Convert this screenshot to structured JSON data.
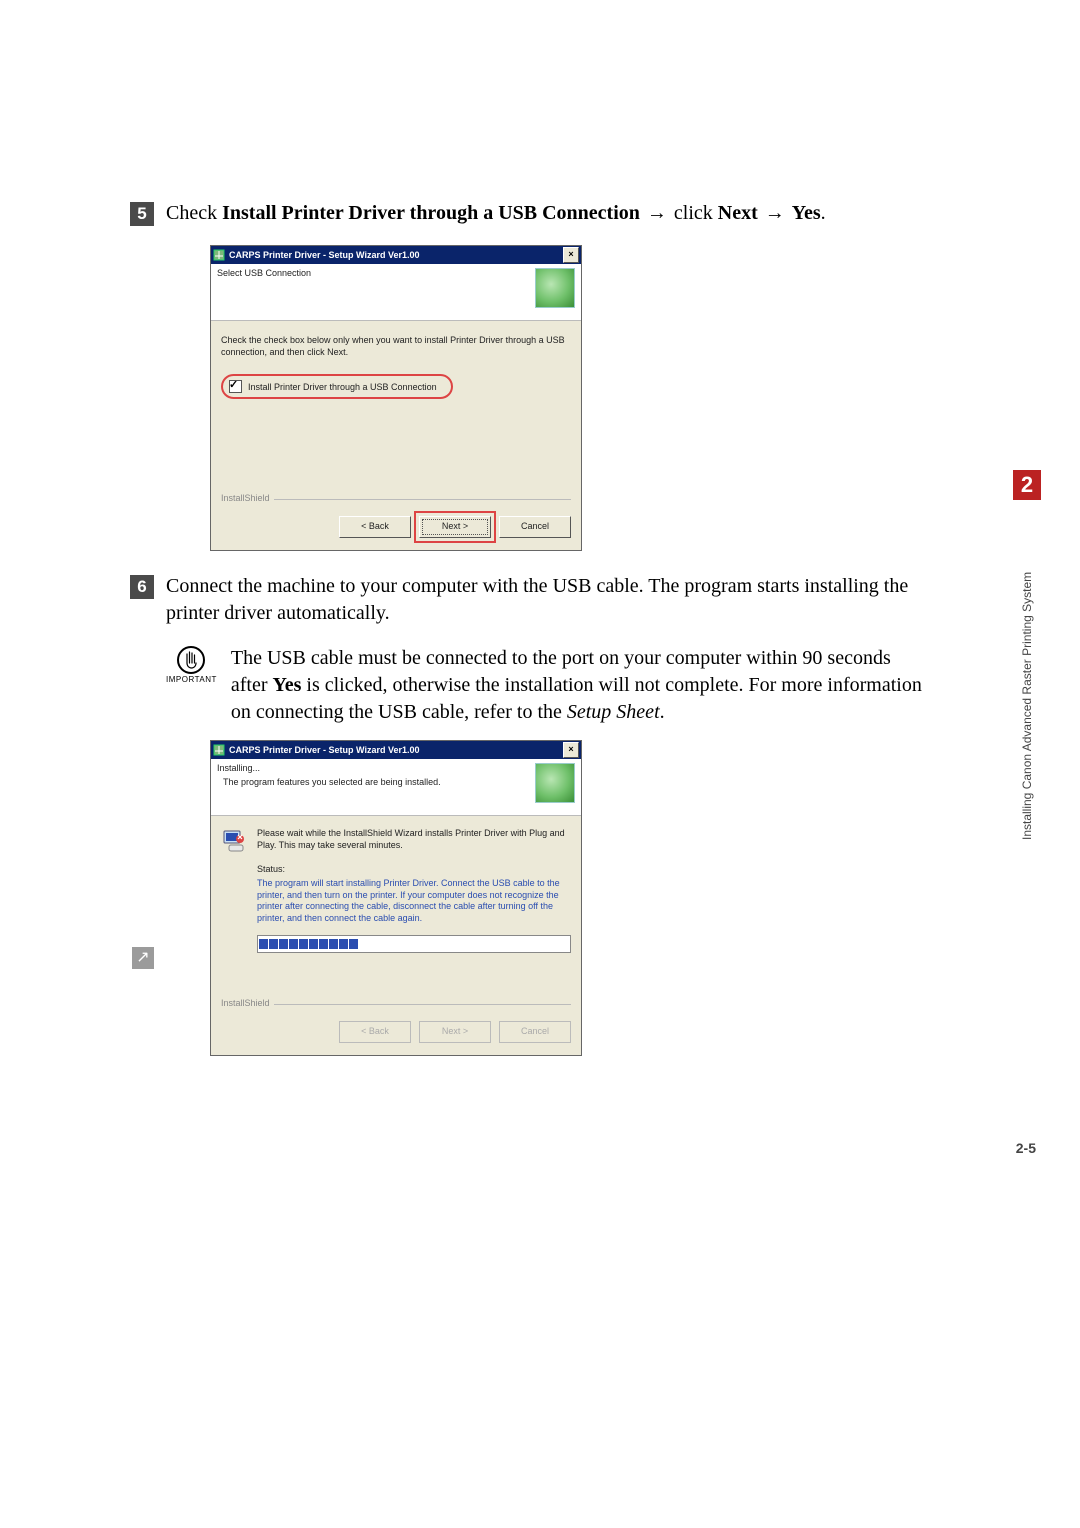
{
  "page": {
    "chapter_number": "2",
    "side_label": "Installing Canon Advanced Raster Printing System",
    "page_number": "2-5"
  },
  "step5": {
    "number": "5",
    "prefix": "Check ",
    "bold1": "Install Printer Driver through a USB Connection",
    "mid1": " ",
    "arrow1": "→",
    "mid2": " click ",
    "bold2": "Next",
    "mid3": " ",
    "arrow2": "→",
    "mid4": " ",
    "bold3": "Yes",
    "suffix": "."
  },
  "dialog1": {
    "title": "CARPS Printer Driver - Setup Wizard Ver1.00",
    "close_label": "×",
    "head_title": "Select USB Connection",
    "hint": "Check the check box below only when you want to install Printer Driver through a USB connection, and then click Next.",
    "checkbox_label": "Install Printer Driver through a USB Connection",
    "install_shield": "InstallShield",
    "back": "< Back",
    "next": "Next >",
    "cancel": "Cancel"
  },
  "step6": {
    "number": "6",
    "text": "Connect the machine to your computer with the USB cable. The program starts installing the printer driver automatically."
  },
  "important": {
    "label": "IMPORTANT",
    "text_prefix": "The USB cable must be connected to the port on your computer within 90 seconds after ",
    "yes": "Yes",
    "text_mid": " is clicked, otherwise the installation will not complete. For more information on connecting the USB cable, refer to the ",
    "setup_sheet": "Setup Sheet",
    "text_suffix": "."
  },
  "dialog2": {
    "title": "CARPS Printer Driver - Setup Wizard Ver1.00",
    "close_label": "×",
    "head_title": "Installing...",
    "head_sub": "The program features you selected are being installed.",
    "please_text": "Please wait while the InstallShield Wizard installs Printer Driver with Plug and Play. This may take several minutes.",
    "status_label": "Status:",
    "status_text": "The program will start installing Printer Driver. Connect the USB cable to the printer, and then turn on the printer. If your computer does not recognize the printer after connecting the cable, disconnect the cable after turning off the printer, and then connect the cable again.",
    "install_shield": "InstallShield",
    "back": "< Back",
    "next": "Next >",
    "cancel": "Cancel",
    "progress_segments": 10
  }
}
